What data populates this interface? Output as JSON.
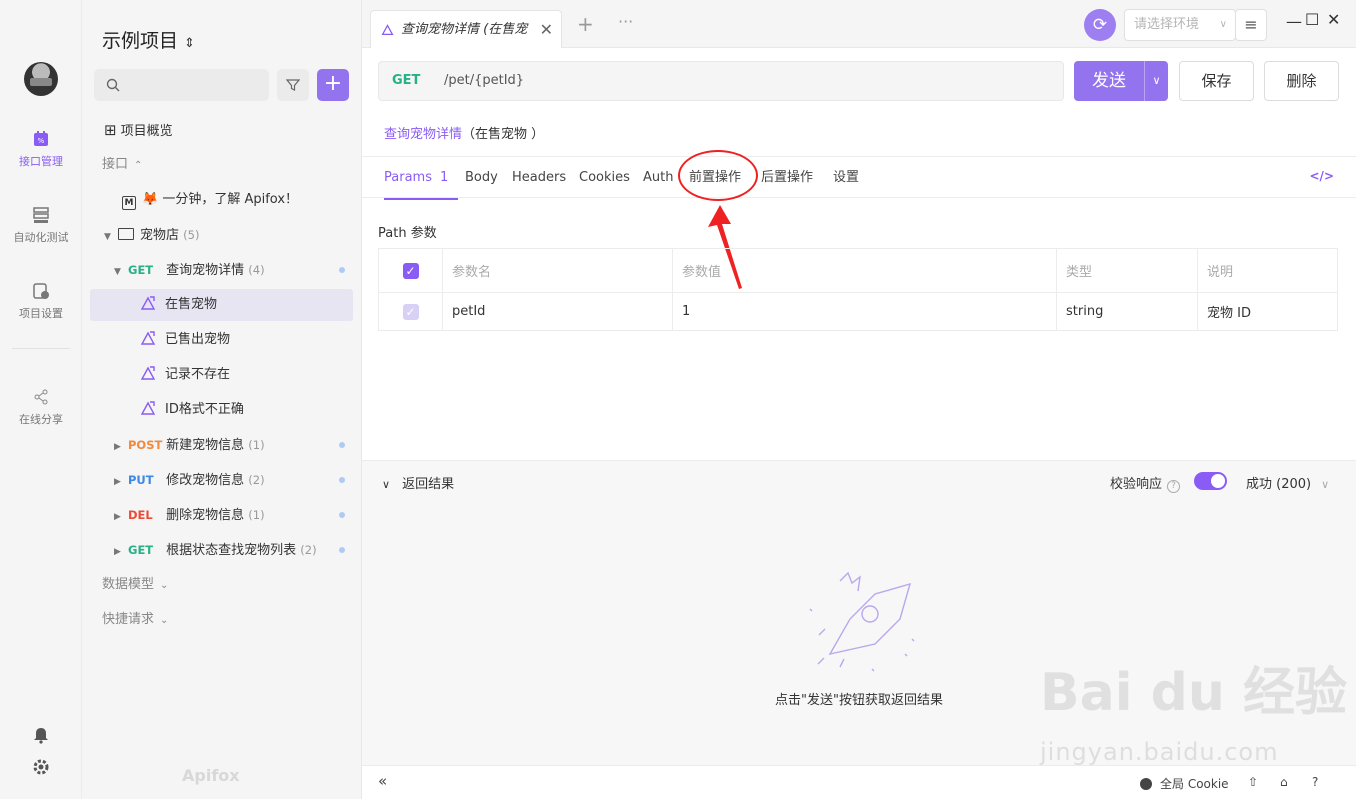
{
  "rail": {
    "items": [
      {
        "label": "接口管理",
        "icon": "api-management-icon"
      },
      {
        "label": "自动化测试",
        "icon": "auto-test-icon"
      },
      {
        "label": "项目设置",
        "icon": "project-settings-icon"
      },
      {
        "label": "在线分享",
        "icon": "share-icon"
      }
    ]
  },
  "tree": {
    "project_name": "示例项目",
    "project_chevron": "⌃⌄",
    "overview": "项目概览",
    "section_api": "接口",
    "intro_doc": "🦊 一分钟，了解 Apifox！",
    "folder": {
      "name": "宠物店",
      "count": "(5)"
    },
    "endpoints": [
      {
        "method": "GET",
        "name": "查询宠物详情",
        "count": "(4)"
      },
      {
        "method": "POST",
        "name": "新建宠物信息",
        "count": "(1)"
      },
      {
        "method": "PUT",
        "name": "修改宠物信息",
        "count": "(2)"
      },
      {
        "method": "DEL",
        "name": "删除宠物信息",
        "count": "(1)"
      },
      {
        "method": "GET",
        "name": "根据状态查找宠物列表",
        "count": "(2)"
      }
    ],
    "cases": [
      "在售宠物",
      "已售出宠物",
      "记录不存在",
      "ID格式不正确"
    ],
    "section_models": "数据模型",
    "section_quick": "快捷请求",
    "brand": "Apifox"
  },
  "tabbar": {
    "tab_title": "查询宠物详情 (在售宠",
    "env_placeholder": "请选择环境"
  },
  "request": {
    "method": "GET",
    "path": "/pet/{petId}",
    "send": "发送",
    "save": "保存",
    "delete": "删除",
    "api_name": "查询宠物详情",
    "case_name": "（在售宠物 ）"
  },
  "subtabs": [
    {
      "label": "Params",
      "badge": "1"
    },
    {
      "label": "Body"
    },
    {
      "label": "Headers"
    },
    {
      "label": "Cookies"
    },
    {
      "label": "Auth"
    },
    {
      "label": "前置操作"
    },
    {
      "label": "后置操作"
    },
    {
      "label": "设置"
    }
  ],
  "params": {
    "title": "Path 参数",
    "headers": [
      "参数名",
      "参数值",
      "类型",
      "说明"
    ],
    "rows": [
      {
        "name": "petId",
        "value": "1",
        "type": "string",
        "desc": "宠物 ID"
      }
    ]
  },
  "result": {
    "title": "返回结果",
    "verify": "校验响应",
    "status": "成功 (200)",
    "hint": "点击\"发送\"按钮获取返回结果"
  },
  "bottombar": {
    "cookie": "全局 Cookie"
  },
  "watermark": {
    "logo": "Bai du 经验",
    "url": "jingyan.baidu.com"
  },
  "colors": {
    "accent": "#8a5cf5",
    "get": "#28b086",
    "post": "#f08a3c",
    "put": "#3d87e5",
    "del": "#ec4b37",
    "annotation": "#e22222"
  }
}
